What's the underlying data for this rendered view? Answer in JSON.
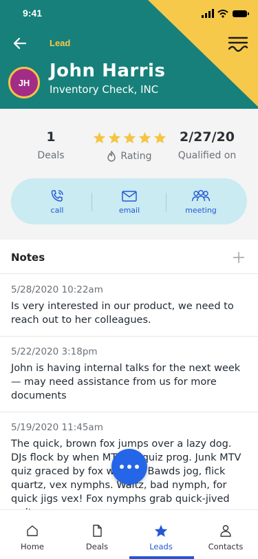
{
  "status_bar": {
    "time": "9:41"
  },
  "header": {
    "section_label": "Lead",
    "avatar_initials": "JH",
    "name": "John Harris",
    "company": "Inventory Check, INC"
  },
  "stats": {
    "deals": {
      "value": "1",
      "label": "Deals"
    },
    "rating": {
      "stars": 5,
      "max_stars": 5,
      "label": "Rating"
    },
    "qualified": {
      "value": "2/27/20",
      "label": "Qualified on"
    }
  },
  "actions": [
    {
      "label": "call",
      "icon": "phone-icon"
    },
    {
      "label": "email",
      "icon": "envelope-icon"
    },
    {
      "label": "meeting",
      "icon": "people-icon"
    }
  ],
  "notes": {
    "title": "Notes",
    "items": [
      {
        "date": "5/28/2020 10:22am",
        "text": "Is very interested in our product, we need to reach out to her colleagues."
      },
      {
        "date": "5/22/2020 3:18pm",
        "text": "John is having internal talks for the next week — may need assistance from us for more documents"
      },
      {
        "date": "5/19/2020 11:45am",
        "text": "The quick, brown fox jumps over a lazy dog. DJs flock by when MTV ax quiz prog. Junk MTV quiz graced by fox whelps. Bawds jog, flick quartz, vex nymphs. Waltz, bad nymph, for quick jigs vex! Fox nymphs grab quick-jived waltz."
      }
    ]
  },
  "tabs": [
    {
      "label": "Home",
      "icon": "home-icon",
      "active": false
    },
    {
      "label": "Deals",
      "icon": "document-icon",
      "active": false
    },
    {
      "label": "Leads",
      "icon": "star-icon",
      "active": true
    },
    {
      "label": "Contacts",
      "icon": "person-icon",
      "active": false
    }
  ],
  "colors": {
    "header_teal": "#17807a",
    "accent_yellow": "#f6c94a",
    "avatar_purple": "#a32c87",
    "action_pill": "#c9ebf1",
    "primary_blue": "#2457d6",
    "fab_blue": "#2566e8"
  }
}
